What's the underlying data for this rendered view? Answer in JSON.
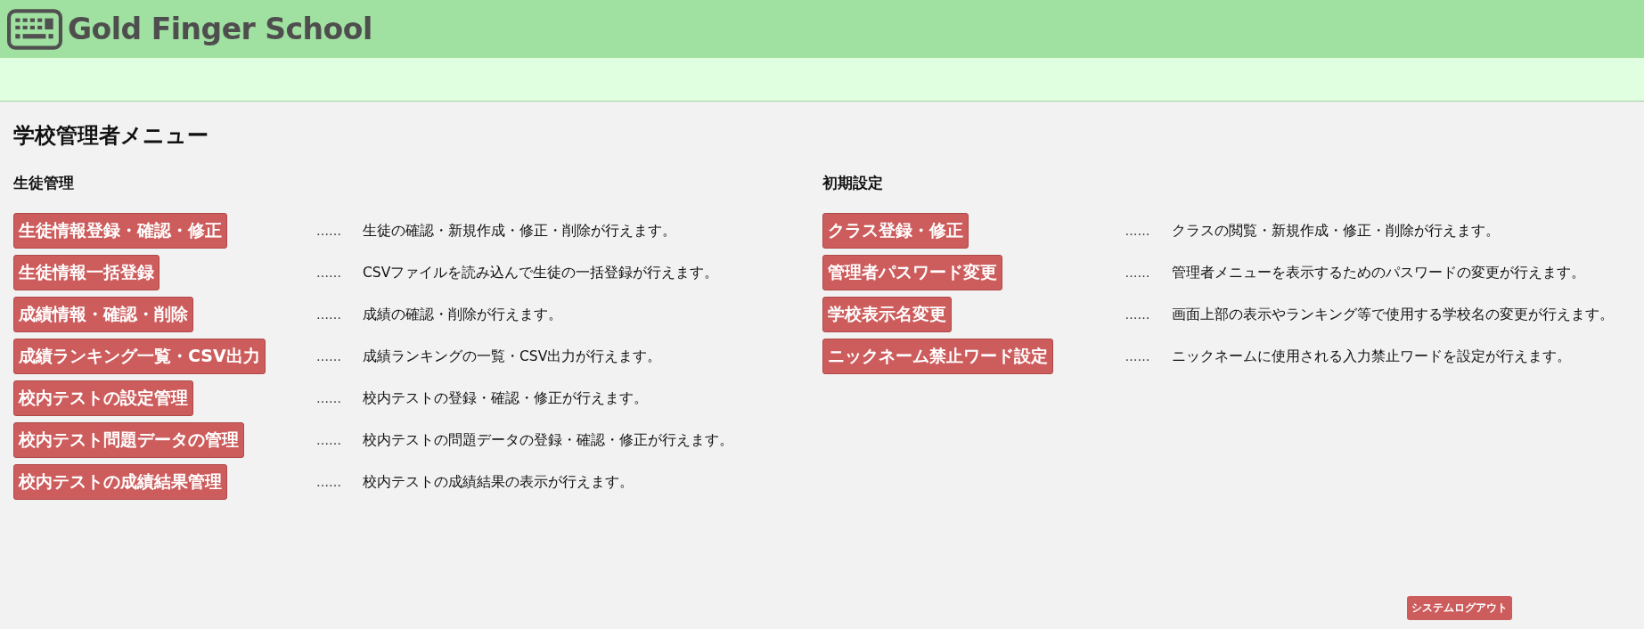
{
  "header": {
    "logo_text": "Gold Finger School"
  },
  "page_title": "学校管理者メニュー",
  "sections": [
    {
      "heading": "生徒管理",
      "items": [
        {
          "label": "生徒情報登録・確認・修正",
          "separator": "……",
          "description": "生徒の確認・新規作成・修正・削除が行えます。"
        },
        {
          "label": "生徒情報一括登録",
          "separator": "……",
          "description": "CSVファイルを読み込んで生徒の一括登録が行えます。"
        },
        {
          "label": "成績情報・確認・削除",
          "separator": "……",
          "description": "成績の確認・削除が行えます。"
        },
        {
          "label": "成績ランキング一覧・CSV出力",
          "separator": "……",
          "description": "成績ランキングの一覧・CSV出力が行えます。"
        },
        {
          "label": "校内テストの設定管理",
          "separator": "……",
          "description": "校内テストの登録・確認・修正が行えます。"
        },
        {
          "label": "校内テスト問題データの管理",
          "separator": "……",
          "description": "校内テストの問題データの登録・確認・修正が行えます。"
        },
        {
          "label": "校内テストの成績結果管理",
          "separator": "……",
          "description": "校内テストの成績結果の表示が行えます。"
        }
      ]
    },
    {
      "heading": "初期設定",
      "items": [
        {
          "label": "クラス登録・修正",
          "separator": "……",
          "description": "クラスの閲覧・新規作成・修正・削除が行えます。"
        },
        {
          "label": "管理者パスワード変更",
          "separator": "……",
          "description": "管理者メニューを表示するためのパスワードの変更が行えます。"
        },
        {
          "label": "学校表示名変更",
          "separator": "……",
          "description": "画面上部の表示やランキング等で使用する学校名の変更が行えます。"
        },
        {
          "label": "ニックネーム禁止ワード設定",
          "separator": "……",
          "description": "ニックネームに使用される入力禁止ワードを設定が行えます。"
        }
      ]
    }
  ],
  "logout_button": "システムログアウト"
}
